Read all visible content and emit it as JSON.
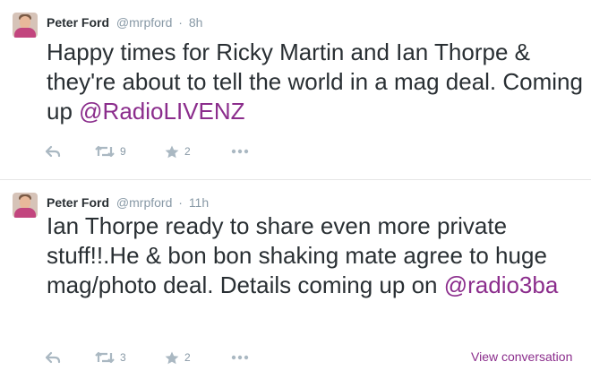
{
  "tweets": [
    {
      "name": "Peter Ford",
      "handle": "@mrpford",
      "separator": "·",
      "time": "8h",
      "text": "Happy times for Ricky Martin and Ian Thorpe & they're about to tell the world in a mag deal. Coming up ",
      "mention": "@RadioLIVENZ",
      "retweets": "9",
      "favorites": "2"
    },
    {
      "name": "Peter Ford",
      "handle": "@mrpford",
      "separator": "·",
      "time": "11h",
      "text": "Ian Thorpe ready to share even more private stuff!!.He & bon bon shaking mate agree to huge mag/photo deal. Details coming up on ",
      "mention": "@radio3ba",
      "retweets": "3",
      "favorites": "2",
      "view_conversation": "View conversation"
    }
  ],
  "icons": {
    "reply": "reply-icon",
    "retweet": "retweet-icon",
    "favorite": "star-icon",
    "more": "more-dots-icon"
  },
  "colors": {
    "text": "#292f33",
    "muted": "#8899a6",
    "link": "#8b2d8c",
    "icon": "#aab8c2"
  }
}
